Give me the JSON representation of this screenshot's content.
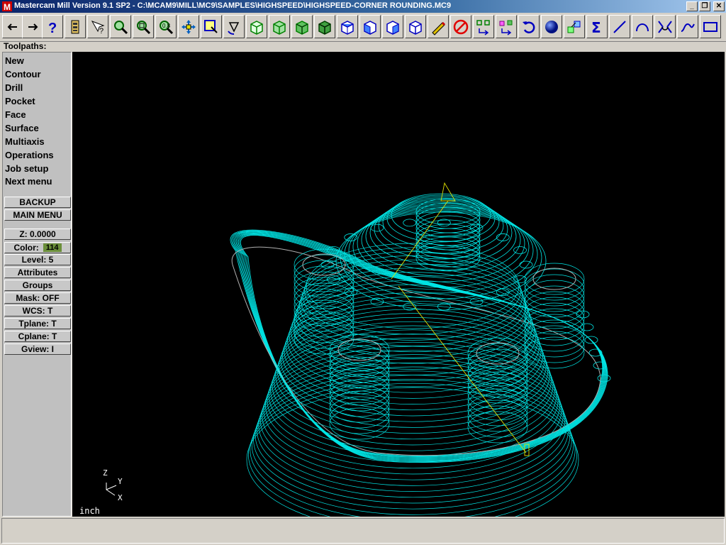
{
  "window": {
    "title": "Mastercam Mill Version 9.1 SP2 - C:\\MCAM9\\MILL\\MC9\\SAMPLES\\HIGHSPEED\\HIGHSPEED-CORNER ROUNDING.MC9",
    "minimize": "_",
    "restore": "❐",
    "close": "✕"
  },
  "toolbar": {
    "icons": [
      "back-arrow-icon",
      "forward-arrow-icon",
      "help-icon",
      "settings-icon",
      "pick-help-icon",
      "zoom-window-icon",
      "unzoom-icon",
      "fit-icon",
      "pan-icon",
      "screen-select-icon",
      "rotate-view-icon",
      "gview-top-icon",
      "gview-front-icon",
      "gview-side-icon",
      "gview-iso-icon",
      "cplane-top-icon",
      "cplane-front-icon",
      "cplane-side-icon",
      "cplane-iso-icon",
      "repaint-icon",
      "clear-icon",
      "transform-icon",
      "translate-icon",
      "undo-icon",
      "shade-icon",
      "level-icon",
      "sum-icon",
      "line-icon",
      "arc-icon",
      "fillet-icon",
      "spline-icon",
      "rectangle-icon"
    ]
  },
  "toolpaths_label": "Toolpaths:",
  "menu": {
    "items": [
      "New",
      "Contour",
      "Drill",
      "Pocket",
      "Face",
      "Surface",
      "Multiaxis",
      "Operations",
      "Job setup",
      "Next menu"
    ]
  },
  "buttons": {
    "backup": "BACKUP",
    "main_menu": "MAIN MENU"
  },
  "status": {
    "z": "Z:  0.0000",
    "color_label": "Color:",
    "color_value": "114",
    "level": "Level:  5",
    "attributes": "Attributes",
    "groups": "Groups",
    "mask": "Mask:  OFF",
    "wcs": "WCS:  T",
    "tplane": "Tplane:  T",
    "cplane": "Cplane:  T",
    "gview": "Gview:  I"
  },
  "viewport": {
    "units": "inch",
    "axis_z": "Z",
    "axis_y": "Y",
    "axis_x": "X",
    "toolpath_color": "#00e5e5",
    "geometry_color": "#b0b0b0"
  }
}
